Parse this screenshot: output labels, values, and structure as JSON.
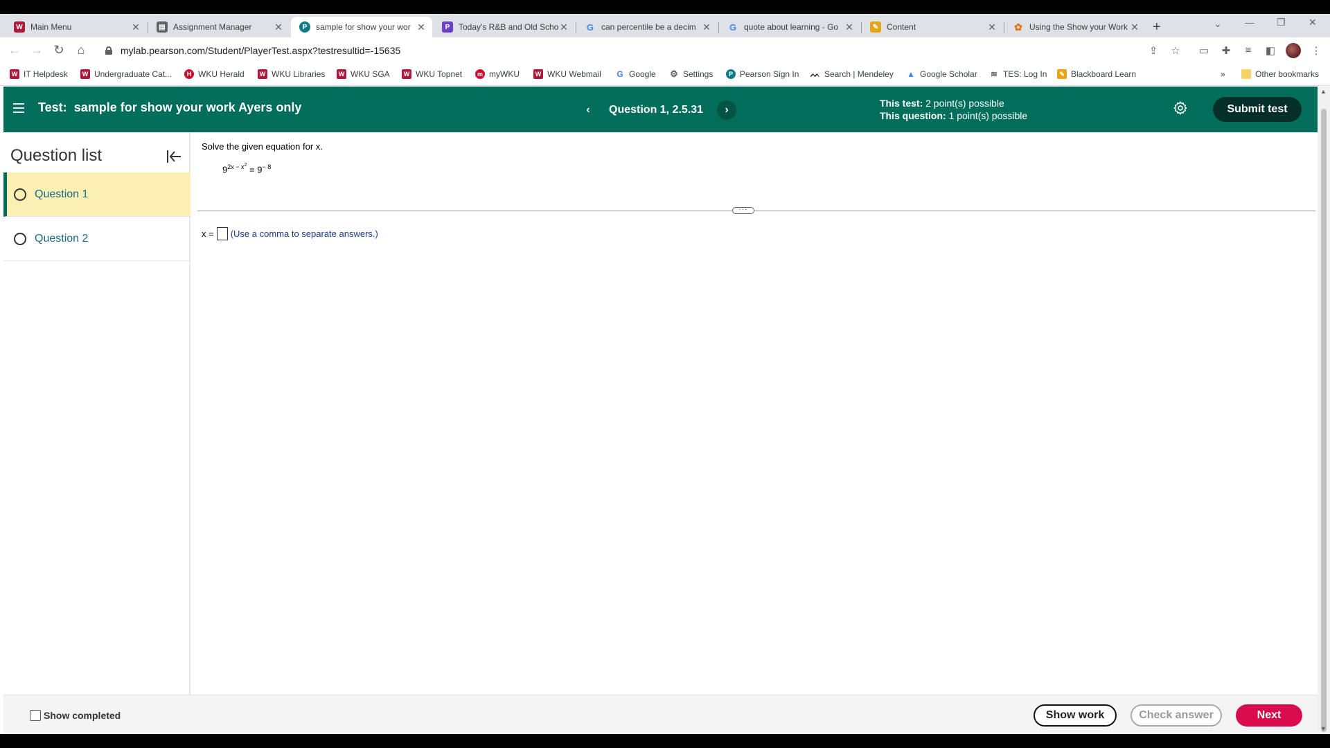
{
  "tabs": [
    {
      "title": "Main Menu",
      "icon": "wku-icon"
    },
    {
      "title": "Assignment Manager",
      "icon": "doc-icon"
    },
    {
      "title": "sample for show your wor",
      "icon": "pearson-icon"
    },
    {
      "title": "Today's R&B and Old Scho",
      "icon": "pandora-icon"
    },
    {
      "title": "can percentile be a decim",
      "icon": "google-icon"
    },
    {
      "title": "quote about learning - Go",
      "icon": "google-icon"
    },
    {
      "title": "Content",
      "icon": "content-icon"
    },
    {
      "title": "Using the Show your Work",
      "icon": "flower-icon"
    }
  ],
  "address": {
    "url": "mylab.pearson.com/Student/PlayerTest.aspx?testresultid=-15635"
  },
  "bookmarks": [
    "IT Helpdesk",
    "Undergraduate Cat...",
    "WKU Herald",
    "WKU Libraries",
    "WKU SGA",
    "WKU Topnet",
    "myWKU",
    "WKU Webmail",
    "Google",
    "Settings",
    "Pearson Sign In",
    "Search | Mendeley",
    "Google Scholar",
    "TES: Log In",
    "Blackboard Learn"
  ],
  "bookmarks_overflow": "»",
  "other_bookmarks": "Other bookmarks",
  "header": {
    "test_prefix": "Test:",
    "test_title": "sample for show your work Ayers only",
    "question_label": "Question 1, 2.5.31",
    "test_points_label": "This test:",
    "test_points_value": "2 point(s) possible",
    "question_points_label": "This question:",
    "question_points_value": "1 point(s) possible",
    "submit_label": "Submit test"
  },
  "sidebar": {
    "title": "Question list",
    "questions": [
      "Question 1",
      "Question 2"
    ],
    "selected_index": 0
  },
  "question": {
    "prompt": "Solve the given equation for x.",
    "eq_base": "9",
    "eq_exp_a": "2x − x",
    "eq_exp_a_sup": "2",
    "eq_equals": "=",
    "eq_rhs_base": "9",
    "eq_rhs_exp": "− 8",
    "answer_prefix": "x =",
    "answer_value": "",
    "answer_hint": "(Use a comma to separate answers.)"
  },
  "footer": {
    "show_completed": "Show completed",
    "show_work": "Show work",
    "check_answer": "Check answer",
    "next": "Next"
  },
  "colors": {
    "header_bg": "#006e5a",
    "submit_bg": "#05302a",
    "selected_question_bg": "#fcefb4",
    "next_bg": "#d90d4e"
  }
}
